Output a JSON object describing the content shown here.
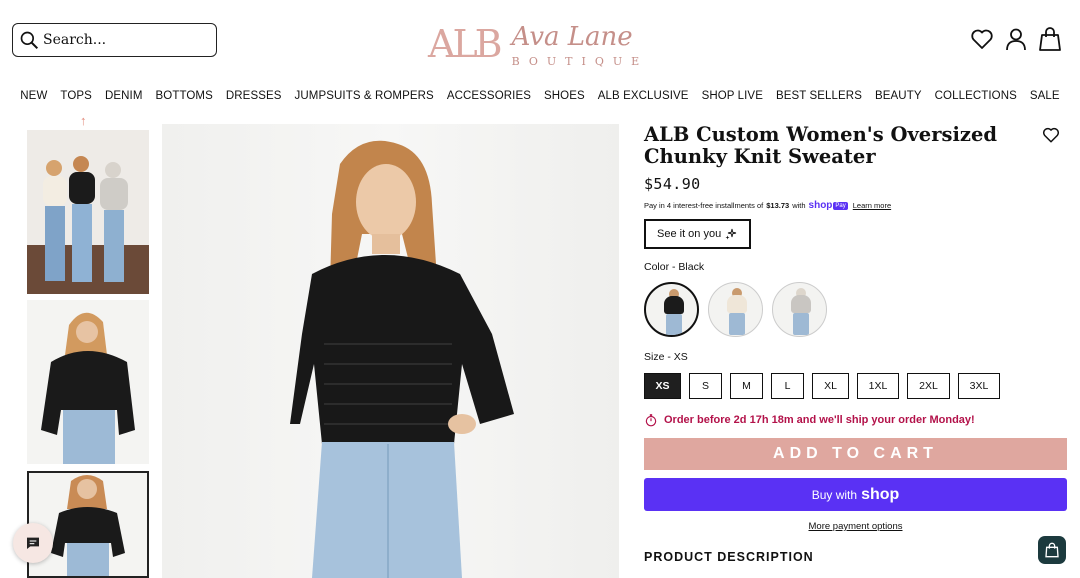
{
  "header": {
    "search_placeholder": "Search...",
    "logo_mark": "ALB",
    "logo_script": "Ava Lane",
    "logo_sub": "BOUTIQUE",
    "icons": [
      "heart-icon",
      "account-icon",
      "shopping-bag-icon"
    ]
  },
  "nav": {
    "items": [
      "NEW",
      "TOPS",
      "DENIM",
      "BOTTOMS",
      "DRESSES",
      "JUMPSUITS & ROMPERS",
      "ACCESSORIES",
      "SHOES",
      "ALB EXCLUSIVE",
      "SHOP LIVE",
      "BEST SELLERS",
      "BEAUTY",
      "COLLECTIONS",
      "SALE"
    ]
  },
  "gallery": {
    "up_arrow": "↑"
  },
  "product": {
    "title": "ALB Custom Women's Oversized Chunky Knit Sweater",
    "price": "$54.90",
    "installments_prefix": "Pay in 4 interest-free installments of",
    "installment_amount": "$13.73",
    "installments_with": "with",
    "shop_word": "shop",
    "pay_chip": "Pay",
    "learn_more": "Learn more",
    "see_it": "See it on you",
    "color_label": "Color - Black",
    "colors": [
      {
        "name": "Black",
        "hex": "#1b1b1b"
      },
      {
        "name": "Cream",
        "hex": "#efe6d8"
      },
      {
        "name": "Grey",
        "hex": "#c9c6c2"
      }
    ],
    "size_label": "Size - XS",
    "sizes": [
      "XS",
      "S",
      "M",
      "L",
      "XL",
      "1XL",
      "2XL",
      "3XL"
    ],
    "selected_size": "XS",
    "ship_note": "Order before 2d 17h 18m and we'll ship your order Monday!",
    "add_to_cart": "ADD TO CART",
    "buy_with": "Buy with",
    "buy_shop_word": "shop",
    "more_payment": "More payment options",
    "description_heading": "PRODUCT DESCRIPTION"
  },
  "colors": {
    "accent_pink": "#dfa79f",
    "shop_purple": "#5a31f4",
    "ship_note_red": "#b3124a",
    "logo_rose": "#c58f89"
  }
}
